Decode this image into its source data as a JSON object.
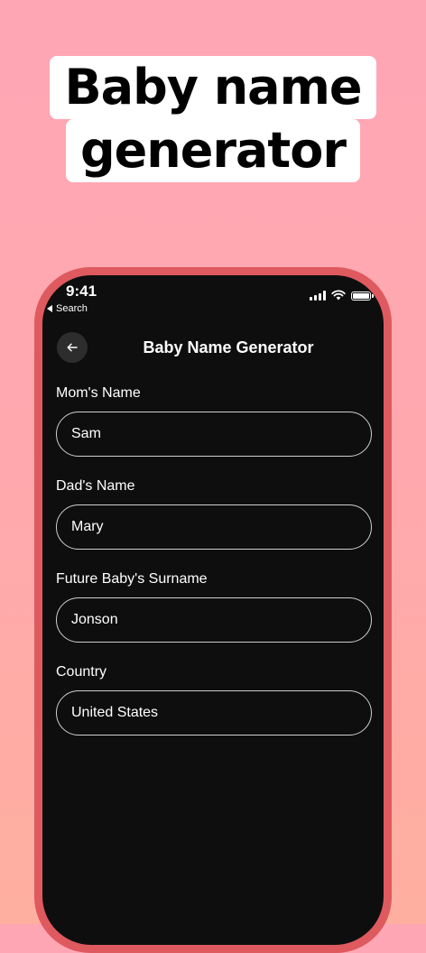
{
  "hero": {
    "line1": "Baby name",
    "line2": "generator"
  },
  "status_bar": {
    "time": "9:41",
    "back_label": "Search",
    "icons": [
      "signal-icon",
      "wifi-icon",
      "battery-icon"
    ]
  },
  "nav": {
    "back_icon": "arrow-left-icon",
    "title": "Baby Name Generator"
  },
  "form": {
    "fields": [
      {
        "label": "Mom's Name",
        "value": "Sam"
      },
      {
        "label": "Dad's Name",
        "value": "Mary"
      },
      {
        "label": "Future Baby's Surname",
        "value": "Jonson"
      },
      {
        "label": "Country",
        "value": "United States"
      }
    ]
  },
  "colors": {
    "background_top": "#ffa6b5",
    "background_bottom": "#ffaf9f",
    "phone_frame": "#de5a5f",
    "screen": "#0e0e0e",
    "input_border": "#cfcfcf"
  }
}
